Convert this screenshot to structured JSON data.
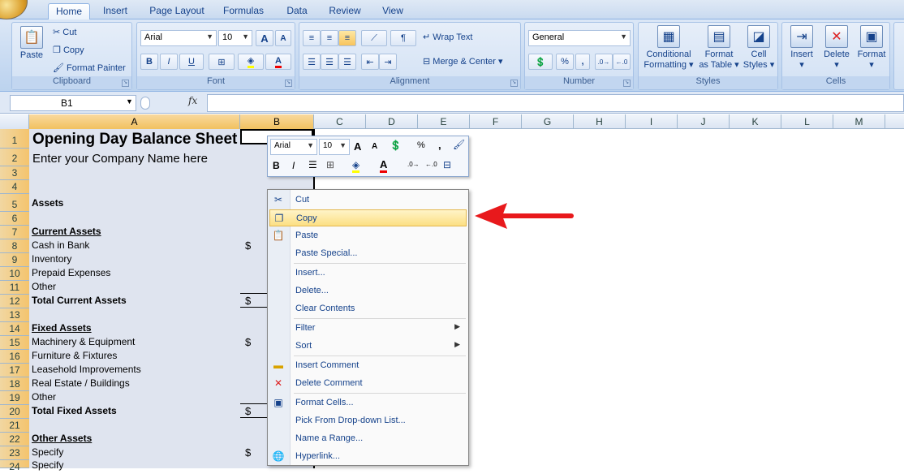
{
  "tabs": [
    "Home",
    "Insert",
    "Page Layout",
    "Formulas",
    "Data",
    "Review",
    "View"
  ],
  "clipboard": {
    "label": "Clipboard",
    "paste": "Paste",
    "cut": "Cut",
    "copy": "Copy",
    "format_painter": "Format Painter"
  },
  "font": {
    "label": "Font",
    "name": "Arial",
    "size": "10",
    "bold": "B",
    "italic": "I",
    "underline": "U",
    "grow": "A",
    "shrink": "A"
  },
  "alignment": {
    "label": "Alignment",
    "wrap": "Wrap Text",
    "merge": "Merge & Center"
  },
  "number": {
    "label": "Number",
    "format": "General",
    "percent": "%",
    "comma": ","
  },
  "styles": {
    "label": "Styles",
    "conditional": "Conditional",
    "conditional2": "Formatting",
    "format_table": "Format",
    "format_table2": "as Table",
    "cell_styles": "Cell",
    "cell_styles2": "Styles"
  },
  "cells": {
    "label": "Cells",
    "insert": "Insert",
    "delete": "Delete",
    "format": "Format"
  },
  "formula_bar": {
    "name_box": "B1",
    "fx": "fx"
  },
  "columns": [
    "A",
    "B",
    "C",
    "D",
    "E",
    "F",
    "G",
    "H",
    "I",
    "J",
    "K",
    "L",
    "M"
  ],
  "rows": [
    "1",
    "2",
    "3",
    "4",
    "5",
    "6",
    "7",
    "8",
    "9",
    "10",
    "11",
    "12",
    "13",
    "14",
    "15",
    "16",
    "17",
    "18",
    "19",
    "20",
    "21",
    "22",
    "23",
    "24"
  ],
  "sheet": {
    "title": "Opening Day Balance Sheet",
    "company": "Enter your Company Name here",
    "r5": "Assets",
    "r7": "Current Assets",
    "r8": "Cash in Bank",
    "r9": "Inventory",
    "r10": "Prepaid Expenses",
    "r11": "Other",
    "r12": "Total Current Assets",
    "r14": "Fixed Assets",
    "r15": "Machinery & Equipment",
    "r16": "Furniture & Fixtures",
    "r17": "Leasehold Improvements",
    "r18": "Real Estate / Buildings",
    "r19": "Other",
    "r20": "Total Fixed Assets",
    "r22": "Other Assets",
    "r23": "Specify",
    "r24": "Specify",
    "dollar": "$"
  },
  "mini_toolbar": {
    "font": "Arial",
    "size": "10",
    "percent": "%",
    "comma": ",",
    "bold": "B",
    "italic": "I"
  },
  "context_menu": {
    "cut": "Cut",
    "copy": "Copy",
    "paste": "Paste",
    "paste_special": "Paste Special...",
    "insert": "Insert...",
    "delete": "Delete...",
    "clear": "Clear Contents",
    "filter": "Filter",
    "sort": "Sort",
    "insert_comment": "Insert Comment",
    "delete_comment": "Delete Comment",
    "format_cells": "Format Cells...",
    "pick_list": "Pick From Drop-down List...",
    "name_range": "Name a Range...",
    "hyperlink": "Hyperlink..."
  },
  "colors": {
    "highlight": "#fcdf83",
    "arrow": "#e8191c",
    "selection": "#dfe4ef"
  }
}
